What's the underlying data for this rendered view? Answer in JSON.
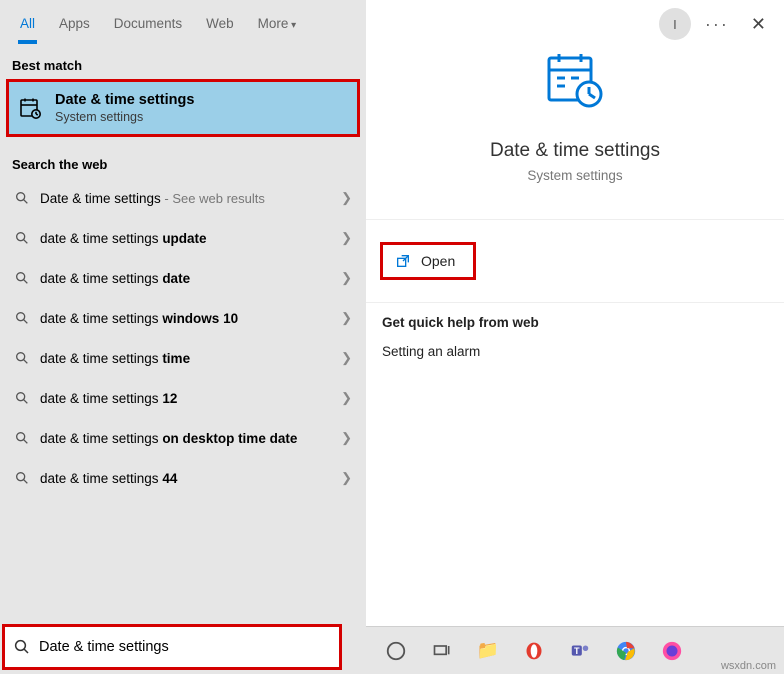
{
  "tabs": {
    "all": "All",
    "apps": "Apps",
    "documents": "Documents",
    "web": "Web",
    "more": "More"
  },
  "avatar_initial": "I",
  "sections": {
    "best_match": "Best match",
    "search_web": "Search the web",
    "help_title": "Get quick help from web"
  },
  "best_match": {
    "title": "Date & time settings",
    "subtitle": "System settings"
  },
  "web": [
    {
      "prefix": "Date & time settings",
      "bold": "",
      "suffix": " - See web results",
      "suffix_sub": true
    },
    {
      "prefix": "date & time settings ",
      "bold": "update",
      "suffix": ""
    },
    {
      "prefix": "date & time settings ",
      "bold": "date",
      "suffix": ""
    },
    {
      "prefix": "date & time settings ",
      "bold": "windows 10",
      "suffix": ""
    },
    {
      "prefix": "date & time settings ",
      "bold": "time",
      "suffix": ""
    },
    {
      "prefix": "date & time settings ",
      "bold": "12",
      "suffix": ""
    },
    {
      "prefix": "date & time settings ",
      "bold": "on desktop time date",
      "suffix": ""
    },
    {
      "prefix": "date & time settings ",
      "bold": "44",
      "suffix": ""
    }
  ],
  "search_value": "Date & time settings",
  "details": {
    "title": "Date & time settings",
    "subtitle": "System settings",
    "open": "Open",
    "help_link": "Setting an alarm"
  },
  "watermark": "wsxdn.com"
}
